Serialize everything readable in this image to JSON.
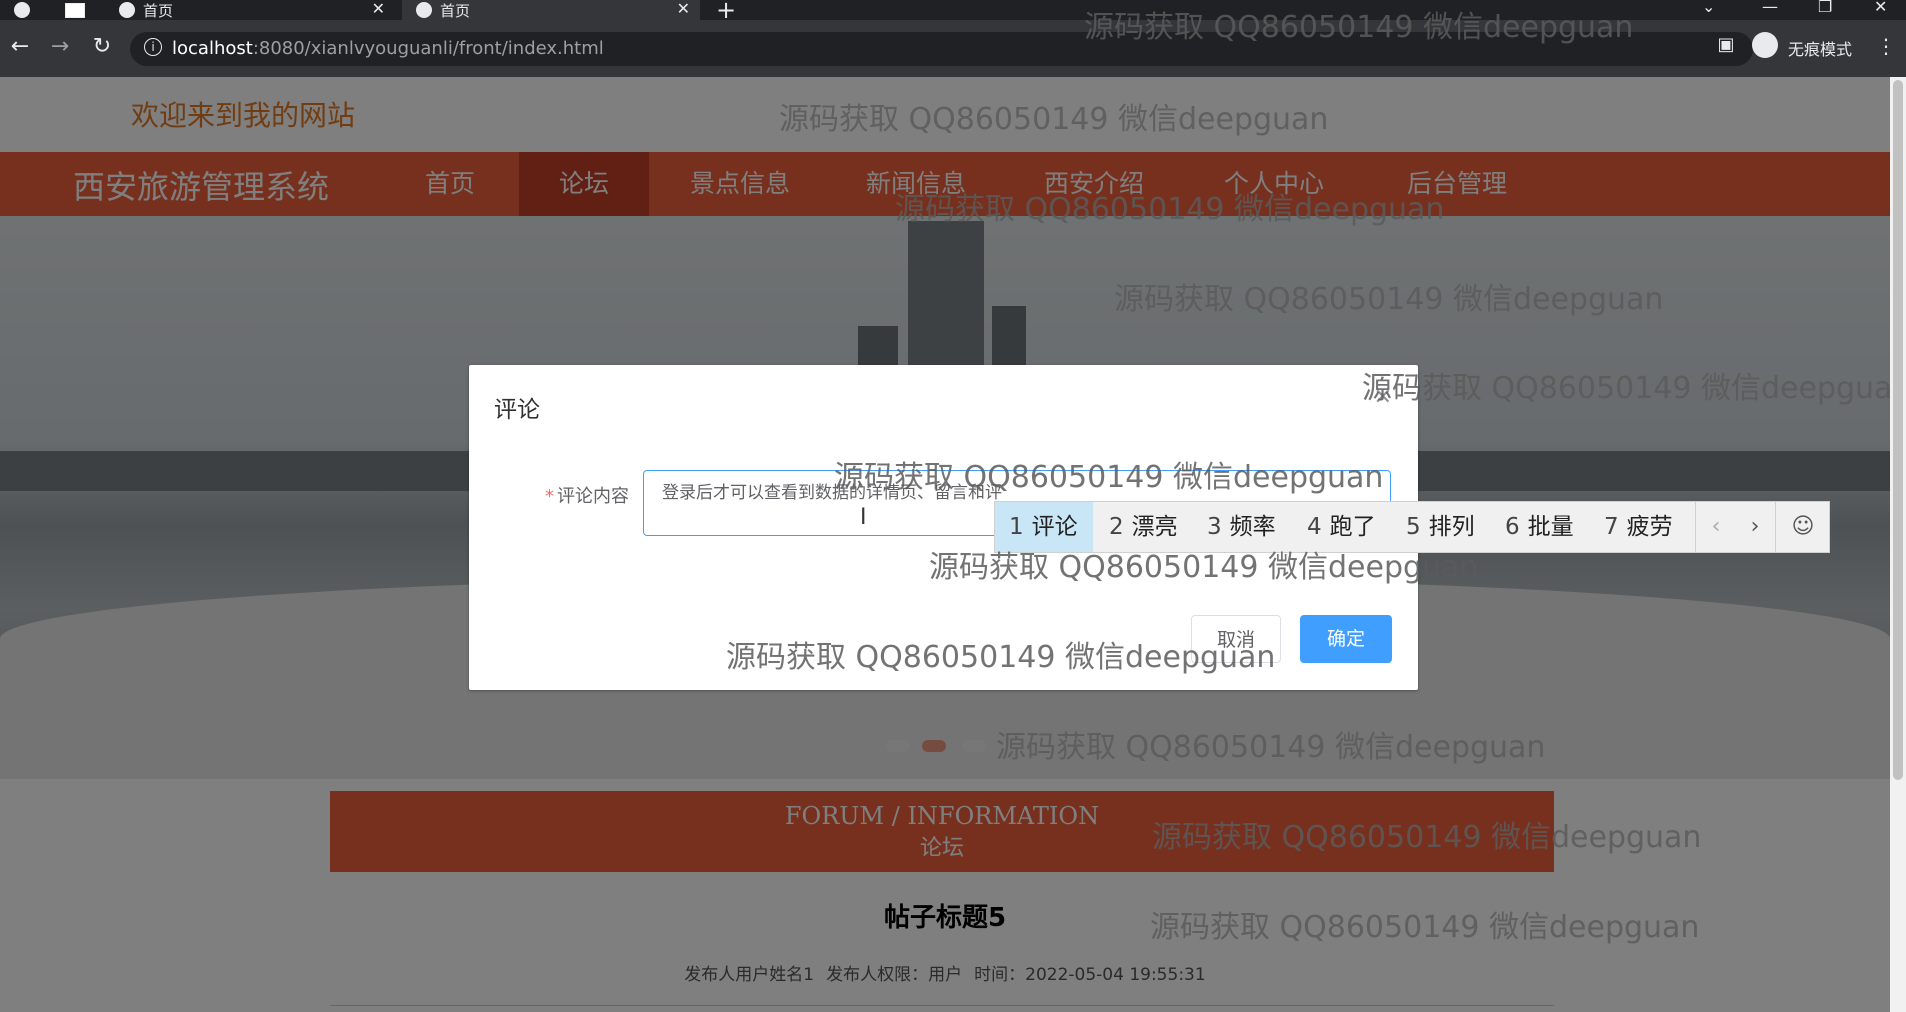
{
  "browser": {
    "tabs": [
      {
        "title": "首页",
        "active": false
      },
      {
        "title": "首页",
        "active": true
      }
    ],
    "new_tab": "+",
    "url_host": "localhost",
    "url_path": ":8080/xianlvyouguanli/front/index.html",
    "incognito_label": "无痕模式",
    "icons": {
      "back": "back-arrow-icon",
      "forward": "forward-arrow-icon",
      "reload": "reload-icon",
      "info": "site-info-icon",
      "star": "bookmark-star-icon"
    }
  },
  "site": {
    "welcome": "欢迎来到我的网站",
    "brand": "西安旅游管理系统",
    "nav": [
      "首页",
      "论坛",
      "景点信息",
      "新闻信息",
      "西安介绍",
      "个人中心",
      "后台管理"
    ],
    "active_nav": "论坛"
  },
  "forum": {
    "banner_en": "FORUM / INFORMATION",
    "banner_cn": "论坛",
    "post_title": "帖子标题5",
    "meta": {
      "author": "发布人用户姓名1",
      "role": "发布人权限：用户",
      "time": "时间：2022-05-04 19:55:31"
    }
  },
  "dialog": {
    "title": "评论",
    "field_label": "评论内容",
    "required_mark": "*",
    "comment_value": "登录后才可以查看到数据的详情页、留言和评",
    "cancel": "取消",
    "confirm": "确定"
  },
  "ime": {
    "candidates": [
      {
        "num": "1",
        "text": "评论"
      },
      {
        "num": "2",
        "text": "漂亮"
      },
      {
        "num": "3",
        "text": "频率"
      },
      {
        "num": "4",
        "text": "跑了"
      },
      {
        "num": "5",
        "text": "排列"
      },
      {
        "num": "6",
        "text": "批量"
      },
      {
        "num": "7",
        "text": "疲劳"
      }
    ],
    "prev": "‹",
    "next": "›",
    "emoji": "☺"
  },
  "watermark": "源码获取 QQ86050149 微信deepguan",
  "colors": {
    "nav_bg": "#f0603c",
    "nav_active": "#c5402b",
    "primary_button": "#409eff",
    "welcome_text": "#e07b27"
  }
}
